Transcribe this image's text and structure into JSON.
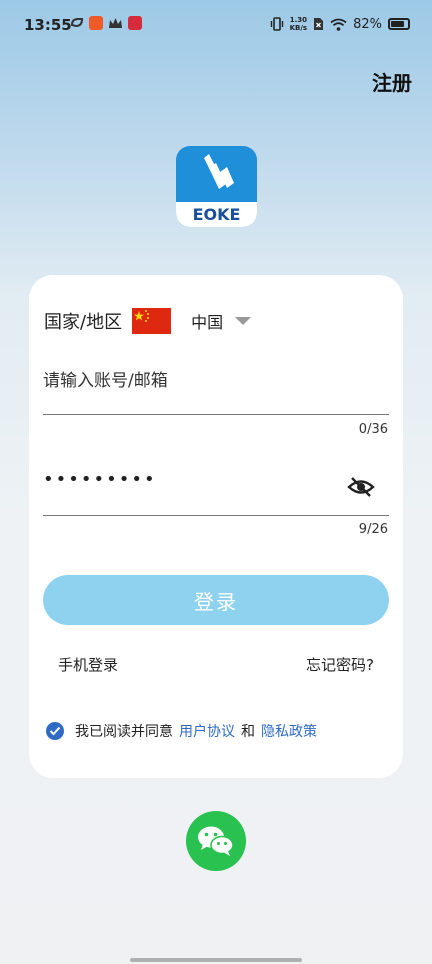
{
  "status_bar": {
    "time": "13:55",
    "net_speed_value": "1.30",
    "net_speed_unit": "KB/s",
    "battery": "82%",
    "battery_level": 0.82
  },
  "header": {
    "register_label": "注册"
  },
  "logo": {
    "text": "EOKE"
  },
  "form": {
    "region_label": "国家/地区",
    "country": "中国",
    "flag_icon": "china-flag-icon",
    "account_placeholder": "请输入账号/邮箱",
    "account_counter": "0/36",
    "password_value": "•••••••••",
    "password_counter": "9/26",
    "login_label": "登录",
    "phone_login_label": "手机登录",
    "forgot_label": "忘记密码?",
    "agree_text": "我已阅读并同意",
    "user_agreement": "用户协议",
    "and_text": "和",
    "privacy_policy": "隐私政策"
  },
  "colors": {
    "accent": "#2f6bc4",
    "login_button": "#8fd2f0",
    "wechat": "#29c14f",
    "logo_blue": "#1e8fd8"
  }
}
